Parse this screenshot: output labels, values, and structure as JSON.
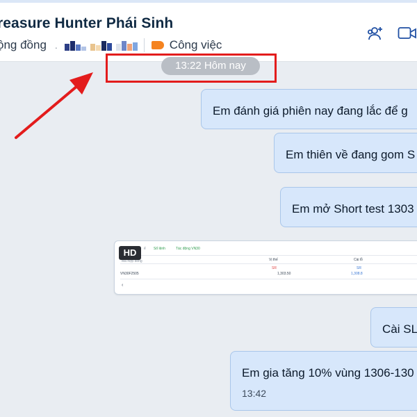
{
  "header": {
    "title": "reasure Hunter Phái Sinh",
    "community_label": "ộng đồng",
    "blurred_prefix": ".",
    "tag_label": "Công việc"
  },
  "timestamp_pill": "13:22 Hôm nay",
  "messages": [
    {
      "text": "Em đánh giá phiên nay đang lắc để g"
    },
    {
      "text": "Em thiên về đang gom S"
    },
    {
      "text": "Em mở Short test 1303"
    },
    {
      "text": "Cài SL"
    },
    {
      "text": "Em gia tăng 10% vùng 1306-130",
      "time": "13:42"
    }
  ],
  "image_card": {
    "badge": "HD",
    "tabs": [
      "ể",
      "Sổ lệnh",
      "Tác động VN30"
    ],
    "col_left_header": "Mã hợp đồng",
    "col_vithe": "Vị thế",
    "col_caile": "Cài lỗ",
    "row_symbol": "VN30F2505",
    "row_vithe_tag": "SR",
    "row_vithe_value": "1,303.50",
    "row_caile_tag": "SR",
    "row_caile_value": "1,308.8",
    "back_arrow": "‹"
  },
  "colors": {
    "bubble_bg": "#d7e7fb",
    "bubble_border": "#a9c6ea",
    "annotation_red": "#e31c1c",
    "tag_orange": "#f5831f",
    "chat_bg": "#e9edf2",
    "header_icon_blue": "#1f4fa3"
  },
  "icons": [
    "add-member-icon",
    "video-call-icon",
    "label-tag-icon"
  ]
}
